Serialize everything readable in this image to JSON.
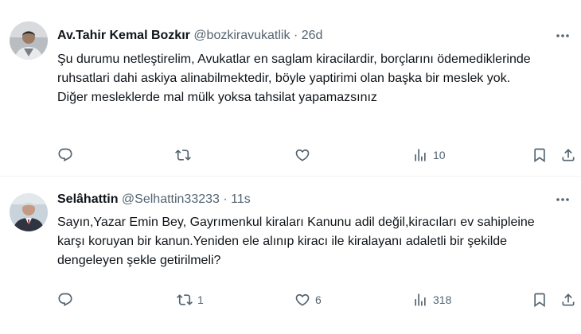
{
  "tweets": [
    {
      "display_name": "Av.Tahir Kemal Bozkır",
      "handle": "@bozkiravukatlik",
      "separator": "·",
      "time": "26d",
      "text_lines": [
        "Şu durumu netleştirelim, Avukatlar en saglam kiracilardir, borçlarını ödemediklerinde ruhsatlari dahi askiya alinabilmektedir, böyle yaptirimi olan başka bir meslek yok.",
        "Diğer mesleklerde mal mülk yoksa tahsilat yapamazsınız"
      ],
      "replies": "",
      "reposts": "",
      "likes": "",
      "views": "10"
    },
    {
      "display_name": "Selâhattin",
      "handle": "@Selhattin33233",
      "separator": "·",
      "time": "11s",
      "text_lines": [
        "Sayın,Yazar Emin Bey, Gayrımenkul kiraları Kanunu adil değil,kiracıları ev sahipleine karşı koruyan bir kanun.Yeniden ele alınıp kiracı ile kiralayanı adaletli bir şekilde dengeleyen şekle getirilmeli?"
      ],
      "replies": "",
      "reposts": "1",
      "likes": "6",
      "views": "318"
    }
  ],
  "icons": {
    "more": "more-dots-icon",
    "reply": "reply-icon",
    "repost": "repost-icon",
    "like": "heart-icon",
    "views": "views-chart-icon",
    "bookmark": "bookmark-icon",
    "share": "share-icon"
  },
  "colors": {
    "text": "#0f1419",
    "secondary": "#536471",
    "divider": "#eff3f4"
  }
}
